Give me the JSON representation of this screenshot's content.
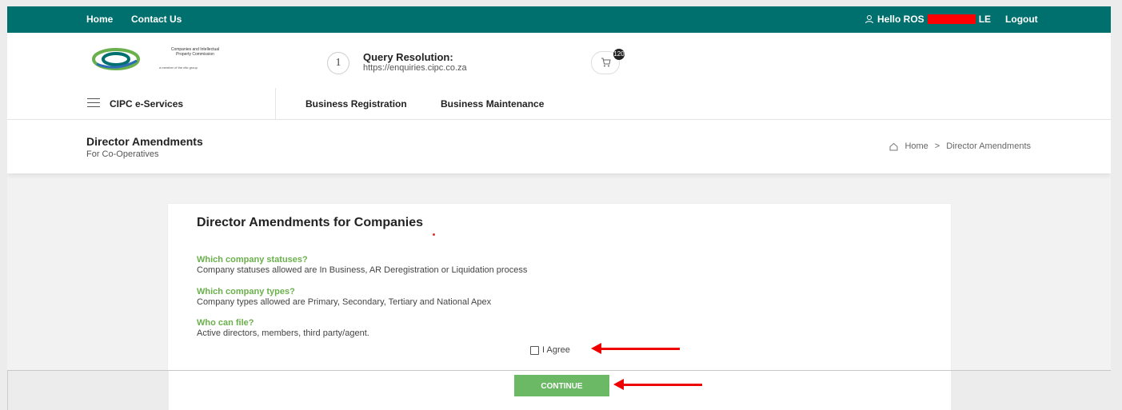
{
  "topbar": {
    "home": "Home",
    "contact": "Contact Us",
    "hello_prefix": "Hello ROS",
    "hello_suffix": "LE",
    "logout": "Logout"
  },
  "header": {
    "logo_line1": "Companies and Intellectual",
    "logo_line2": "Property Commission",
    "logo_sub": "a member of the dtic group",
    "query_number": "1",
    "query_title": "Query Resolution:",
    "query_url": "https://enquiries.cipc.co.za",
    "cart_count": "120"
  },
  "menu": {
    "eservices": "CIPC e-Services",
    "business_registration": "Business Registration",
    "business_maintenance": "Business Maintenance"
  },
  "page": {
    "title": "Director Amendments",
    "subtitle": "For Co-Operatives",
    "breadcrumb_home": "Home",
    "breadcrumb_sep": ">",
    "breadcrumb_current": "Director Amendments"
  },
  "card": {
    "title": "Director Amendments for Companies",
    "q1": "Which company statuses?",
    "a1": "Company statuses allowed are In Business, AR Deregistration or Liquidation process",
    "q2": "Which company types?",
    "a2": "Company types allowed are Primary, Secondary, Tertiary and National Apex",
    "q3": "Who can file?",
    "a3": "Active directors, members, third party/agent.",
    "agree_label": "I Agree"
  },
  "continue_label": "CONTINUE",
  "colors": {
    "topbar": "#00706e",
    "question": "#6ab04c",
    "continue": "#6bb865",
    "annotation_arrow": "#e00000"
  }
}
